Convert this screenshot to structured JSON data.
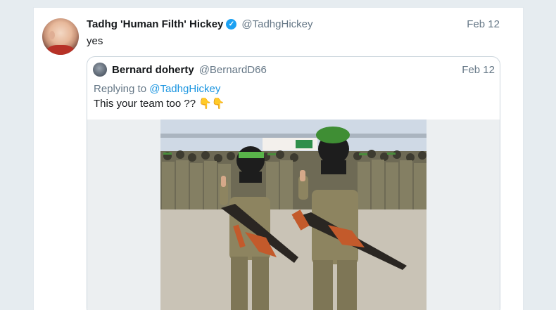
{
  "tweet": {
    "display_name": "Tadhg 'Human Filth' Hickey",
    "verified_icon": "verified-badge-icon",
    "handle": "@TadhgHickey",
    "date": "Feb 12",
    "text": "yes"
  },
  "quoted_tweet": {
    "display_name": "Bernard doherty",
    "handle": "@BernardD66",
    "date": "Feb 12",
    "replying_prefix": "Replying to",
    "replying_to": "@TadhgHickey",
    "text": "This your team too  ?? 👇👇"
  },
  "colors": {
    "link": "#1b95e0",
    "verified": "#1da1f2",
    "secondary_text": "#657786"
  }
}
